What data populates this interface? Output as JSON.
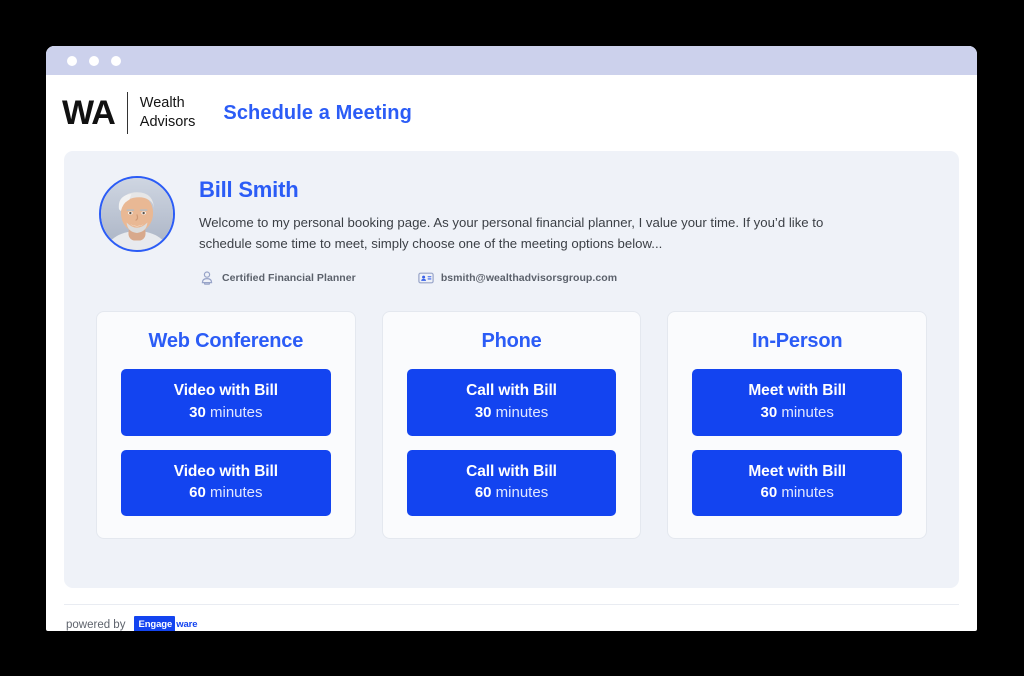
{
  "window": {
    "traffic_dots": [
      "dot-1",
      "dot-2",
      "dot-3"
    ]
  },
  "header": {
    "logo_mark": "WA",
    "logo_word_line1": "Wealth",
    "logo_word_line2": "Advisors",
    "page_title": "Schedule a Meeting",
    "accent_color": "#2b5cf6"
  },
  "profile": {
    "avatar_icon": "user-photo",
    "name": "Bill Smith",
    "description": "Welcome to my personal booking page. As your personal financial planner, I value your time. If you’d like to schedule some time to meet, simply choose one of the meeting options below...",
    "meta": [
      {
        "icon": "person-badge-icon",
        "text": "Certified Financial Planner"
      },
      {
        "icon": "contact-card-icon",
        "text": "bsmith@wealthadvisorsgroup.com"
      }
    ]
  },
  "cards": [
    {
      "title": "Web Conference",
      "options": [
        {
          "title": "Video with Bill",
          "duration": "30",
          "duration_unit": "minutes"
        },
        {
          "title": "Video with Bill",
          "duration": "60",
          "duration_unit": "minutes"
        }
      ]
    },
    {
      "title": "Phone",
      "options": [
        {
          "title": "Call with Bill",
          "duration": "30",
          "duration_unit": "minutes"
        },
        {
          "title": "Call with Bill",
          "duration": "60",
          "duration_unit": "minutes"
        }
      ]
    },
    {
      "title": "In-Person",
      "options": [
        {
          "title": "Meet with Bill",
          "duration": "30",
          "duration_unit": "minutes"
        },
        {
          "title": "Meet with Bill",
          "duration": "60",
          "duration_unit": "minutes"
        }
      ]
    }
  ],
  "footer": {
    "powered_by": "powered by",
    "logo_part1": "Engage",
    "logo_part2": "ware",
    "logo_color": "#1344f0"
  }
}
